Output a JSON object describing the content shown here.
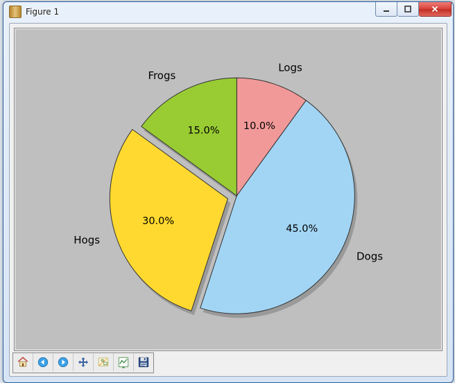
{
  "window": {
    "title": "Figure 1",
    "buttons": {
      "min": "minimize",
      "max": "maximize",
      "close": "close"
    }
  },
  "toolbar": {
    "home": "Home",
    "back": "Back",
    "fwd": "Forward",
    "pan": "Pan",
    "zoom": "Zoom",
    "config": "Configure subplots",
    "save": "Save"
  },
  "chart_data": {
    "type": "pie",
    "title": "",
    "start_angle_deg": 90,
    "direction": "clockwise",
    "slices": [
      {
        "label": "Logs",
        "value": 10.0,
        "pct_text": "10.0%",
        "color": "#f19999",
        "explode": 0
      },
      {
        "label": "Dogs",
        "value": 45.0,
        "pct_text": "45.0%",
        "color": "#a2d5f4",
        "explode": 0
      },
      {
        "label": "Hogs",
        "value": 30.0,
        "pct_text": "30.0%",
        "color": "#ffd92f",
        "explode": 0.08
      },
      {
        "label": "Frogs",
        "value": 15.0,
        "pct_text": "15.0%",
        "color": "#99cc33",
        "explode": 0
      }
    ],
    "shadow": true
  }
}
